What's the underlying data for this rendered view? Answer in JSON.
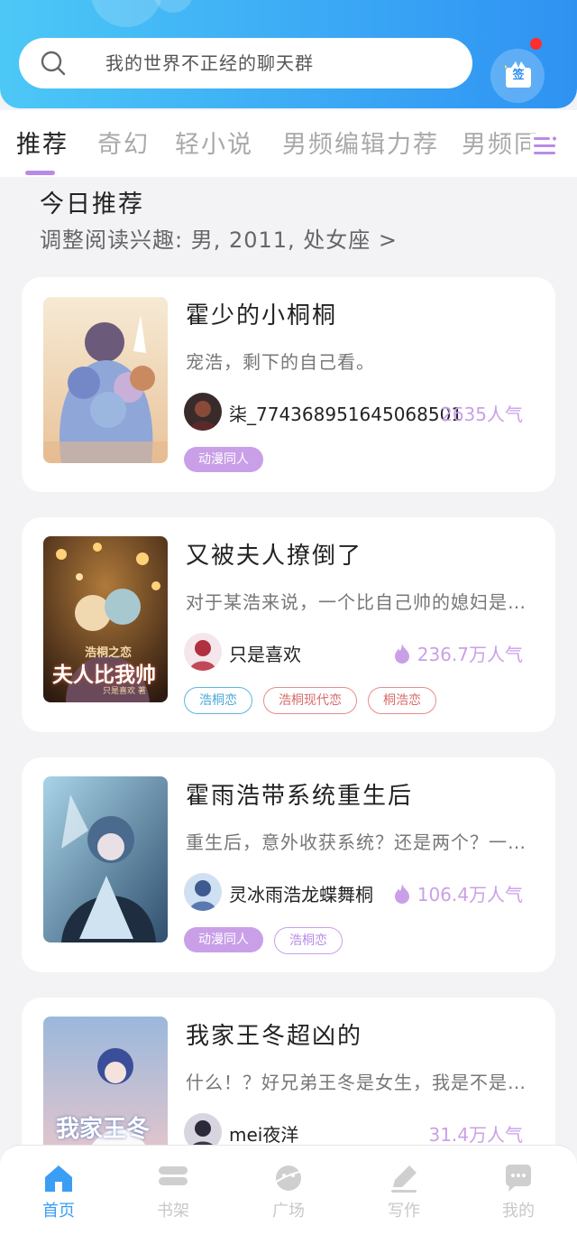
{
  "search": {
    "query": "我的世界不正经的聊天群"
  },
  "signin": {
    "label": "签"
  },
  "tabs": [
    {
      "label": "推荐"
    },
    {
      "label": "奇幻"
    },
    {
      "label": "轻小说"
    },
    {
      "label": "男频编辑力荐"
    },
    {
      "label": "男频同"
    }
  ],
  "today": {
    "title": "今日推荐",
    "subtitle": "调整阅读兴趣: 男, 2011, 处女座 >"
  },
  "books": [
    {
      "title": "霍少的小桐桐",
      "desc": "宠浩，剩下的自己看。",
      "author": "柒_774368951645068501",
      "popularity": "2635人气",
      "tags": [
        "动漫同人"
      ]
    },
    {
      "title": "又被夫人撩倒了",
      "desc": "对于某浩来说，一个比自己帅的媳妇是…",
      "author": "只是喜欢",
      "popularity": "236.7万人气",
      "tags": [
        "浩桐恋",
        "浩桐现代恋",
        "桐浩恋"
      ],
      "cover_text": "夫人比我帅",
      "cover_sub": "浩桐之恋",
      "cover_small": "只是喜欢 著"
    },
    {
      "title": "霍雨浩带系统重生后",
      "desc": "重生后，意外收获系统？还是两个？一…",
      "author": "灵冰雨浩龙蝶舞桐",
      "popularity": "106.4万人气",
      "tags": [
        "动漫同人",
        "浩桐恋"
      ]
    },
    {
      "title": "我家王冬超凶的",
      "desc": "什么！？好兄弟王冬是女生，我是不是…",
      "author": "mei夜洋",
      "popularity": "31.4万人气",
      "tags": [],
      "cover_text": "我家王冬"
    }
  ],
  "nav": [
    {
      "label": "首页"
    },
    {
      "label": "书架"
    },
    {
      "label": "广场"
    },
    {
      "label": "写作"
    },
    {
      "label": "我的"
    }
  ],
  "colors": {
    "accent": "#3a9ef5",
    "purple": "#c9a0e8",
    "header_start": "#4cc8f6",
    "header_end": "#2f92f2"
  }
}
